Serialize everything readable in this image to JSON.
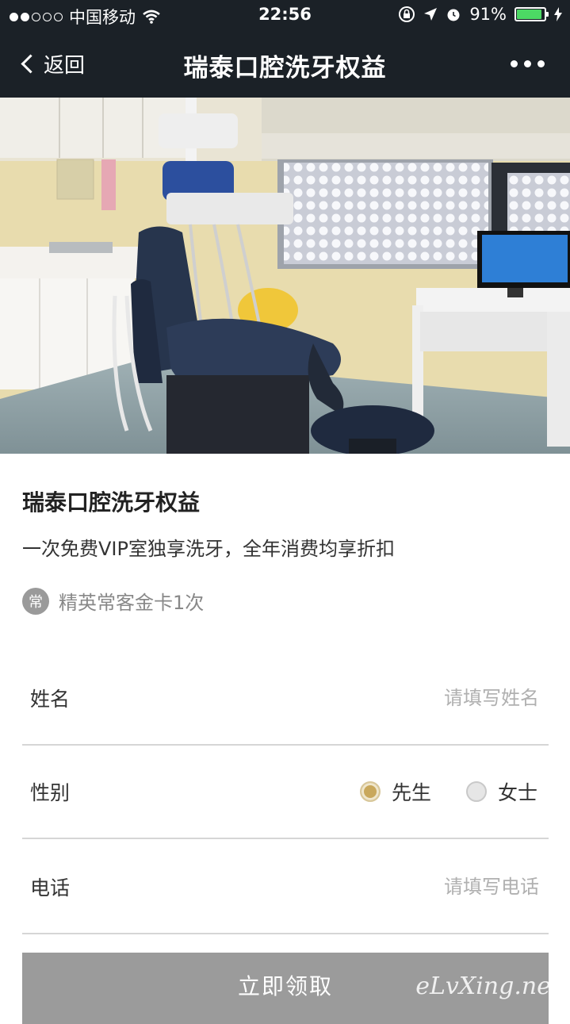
{
  "status_bar": {
    "carrier": "中国移动",
    "time": "22:56",
    "battery": "91%",
    "battery_level": 0.91,
    "battery_color": "#4cd964"
  },
  "nav": {
    "back_label": "返回",
    "title": "瑞泰口腔洗牙权益"
  },
  "benefit": {
    "title": "瑞泰口腔洗牙权益",
    "description": "一次免费VIP室独享洗牙，全年消费均享折扣",
    "badge_char": "常",
    "card_text": "精英常客金卡1次"
  },
  "form": {
    "name_label": "姓名",
    "name_placeholder": "请填写姓名",
    "gender_label": "性别",
    "gender_options": [
      "先生",
      "女士"
    ],
    "gender_selected": "先生",
    "phone_label": "电话",
    "phone_placeholder": "请填写电话",
    "submit_label": "立即领取"
  },
  "watermark": "eLvXing.net",
  "colors": {
    "nav_bg": "#1b2127",
    "radio_selected": "#c9a85c",
    "button_bg": "#9b9b9b"
  }
}
